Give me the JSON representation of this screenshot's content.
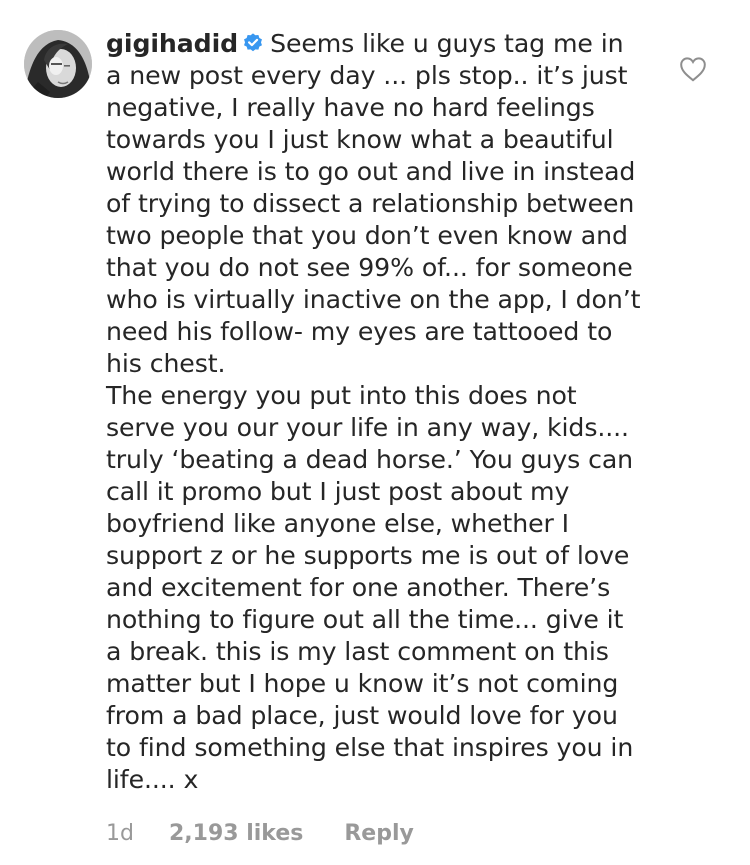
{
  "comment": {
    "username": "gigihadid",
    "verified_icon": "verified-badge-icon",
    "paragraph_1": "Seems like u guys tag me in a new post every day ... pls stop.. it’s just negative, I really have no hard feelings towards you I just know what a beautiful world there is to go out and live in instead of trying to dissect a relationship between two people that you don’t even know and that you do not see 99% of... for someone who is virtually inactive on the app, I don’t need his follow- my eyes are tattooed to his chest.",
    "paragraph_2": "The energy you put into this does not serve you our your life in any way, kids.... truly ‘beating a dead horse.’ You guys can call it promo but I just post about my boyfriend like anyone else, whether I support z or he supports me is out of love and excitement for one another. There’s nothing to figure out all the time... give it a break. this is my last comment on this matter but I hope u know it’s not coming from a bad place, just would love for you to find something else that inspires you in life.... x",
    "age": "1d",
    "likes": "2,193 likes",
    "reply_label": "Reply",
    "like_icon": "heart-outline-icon"
  },
  "colors": {
    "text": "#262626",
    "meta": "#999999",
    "verified": "#3897f0",
    "heart": "#8e8e8e"
  }
}
